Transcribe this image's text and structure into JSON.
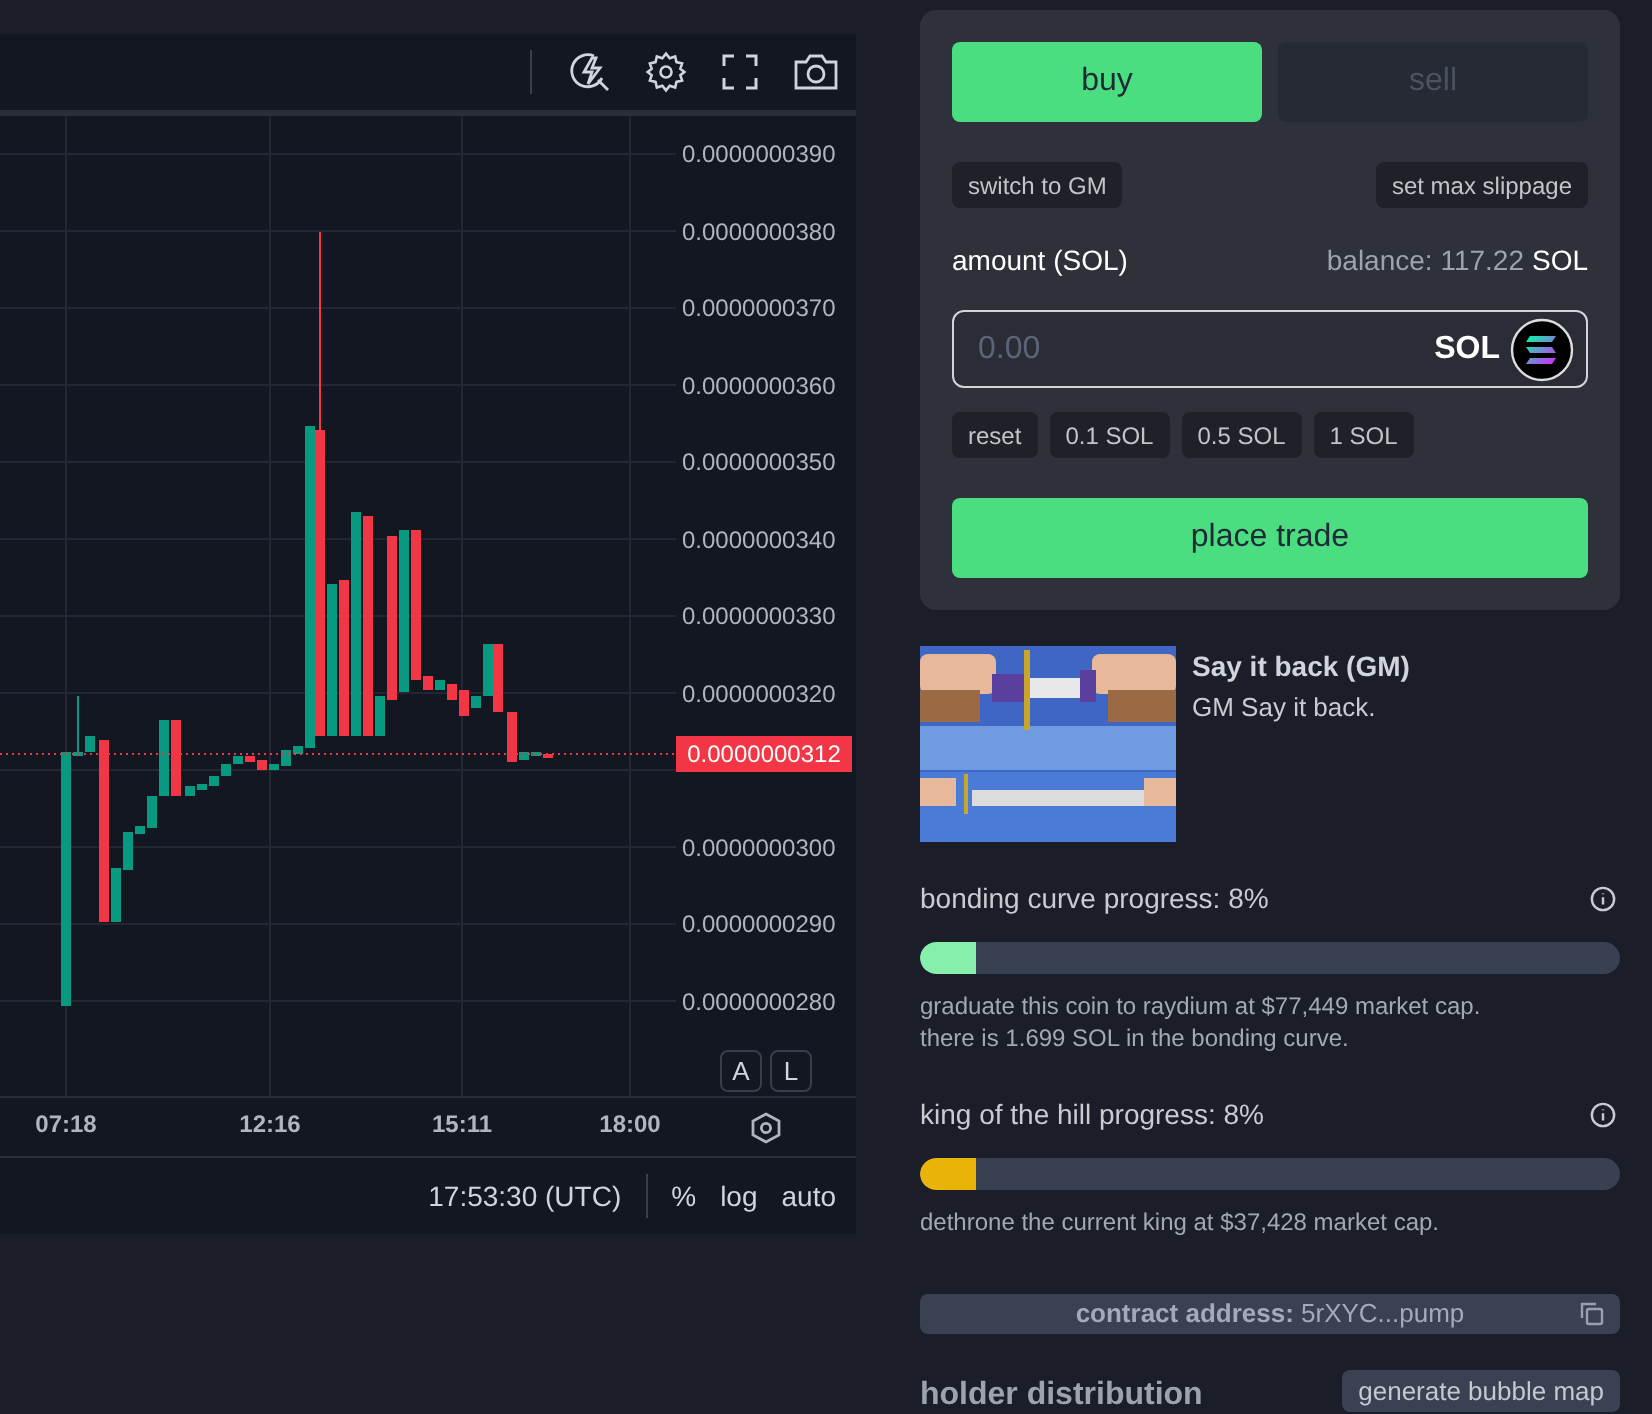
{
  "chart": {
    "price_axis": [
      "0.0000000390",
      "0.0000000380",
      "0.0000000370",
      "0.0000000360",
      "0.0000000350",
      "0.0000000340",
      "0.0000000330",
      "0.0000000320",
      "0.0000000300",
      "0.0000000290",
      "0.0000000280"
    ],
    "current_price": "0.0000000312",
    "time_axis": [
      "07:18",
      "12:16",
      "15:11",
      "18:00"
    ],
    "scale_buttons": [
      "A",
      "L"
    ],
    "footer": {
      "time": "17:53:30 (UTC)",
      "options": [
        "%",
        "log",
        "auto"
      ]
    }
  },
  "trade": {
    "tabs": [
      {
        "label": "buy",
        "selected": true
      },
      {
        "label": "sell",
        "selected": false
      }
    ],
    "switch_button": "switch to GM",
    "slippage_button": "set max slippage",
    "amount_label": "amount (SOL)",
    "balance_label": "balance: 117.22",
    "balance_unit": "SOL",
    "amount_field": {
      "placeholder": "0.00",
      "unit": "SOL"
    },
    "quick_amounts": [
      "reset",
      "0.1 SOL",
      "0.5 SOL",
      "1 SOL"
    ],
    "submit": "place trade"
  },
  "token": {
    "name": "Say it back (GM)",
    "description": "GM Say it back."
  },
  "progress": [
    {
      "label": "bonding curve progress: 8%",
      "level": 0.08,
      "color": "#86efac",
      "notes": [
        "graduate this coin to raydium at $77,449 market cap.",
        "there is 1.699 SOL in the bonding curve."
      ]
    },
    {
      "label": "king of the hill progress: 8%",
      "level": 0.08,
      "color": "#eab308",
      "notes": [
        "dethrone the current king at $37,428 market cap."
      ]
    }
  ],
  "contract": {
    "text": "**contract address:** 5rXYC...pump"
  },
  "holders": {
    "title": "holder distribution",
    "button": "generate bubble map"
  }
}
